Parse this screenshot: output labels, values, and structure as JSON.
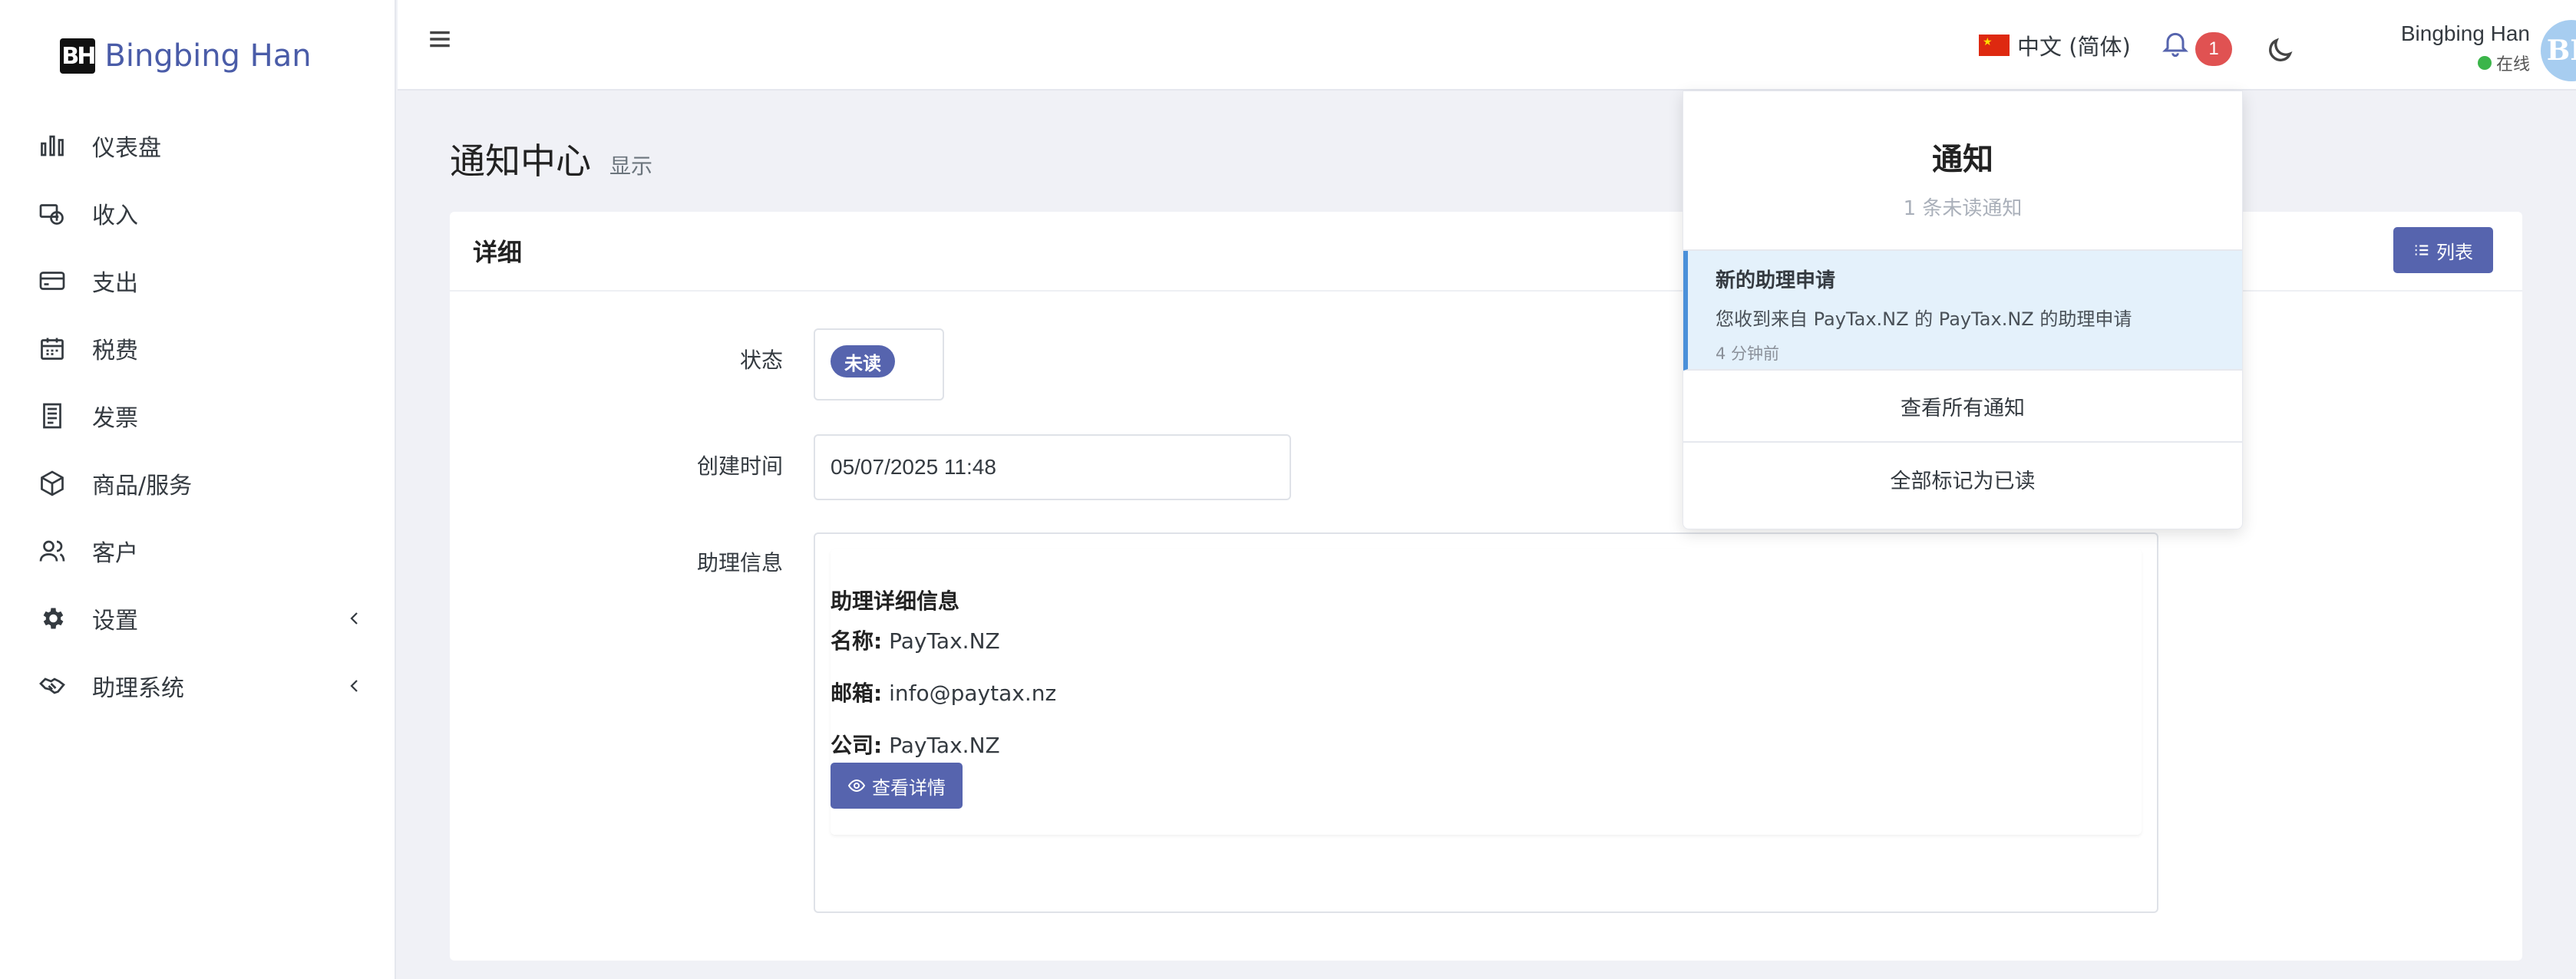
{
  "brand": {
    "logo_text": "BH",
    "name": "Bingbing Han"
  },
  "sidebar": {
    "items": [
      {
        "label": "仪表盘",
        "icon": "bar-chart-icon"
      },
      {
        "label": "收入",
        "icon": "income-icon"
      },
      {
        "label": "支出",
        "icon": "credit-card-icon"
      },
      {
        "label": "税费",
        "icon": "calendar-icon"
      },
      {
        "label": "发票",
        "icon": "receipt-icon"
      },
      {
        "label": "商品/服务",
        "icon": "box-icon"
      },
      {
        "label": "客户",
        "icon": "users-icon"
      },
      {
        "label": "设置",
        "icon": "gear-icon",
        "has_submenu": true
      },
      {
        "label": "助理系统",
        "icon": "handshake-icon",
        "has_submenu": true
      }
    ]
  },
  "topbar": {
    "language": "中文 (简体)",
    "notification_count": "1",
    "user": {
      "name": "Bingbing Han",
      "status": "在线",
      "avatar_initials": "BH"
    }
  },
  "page": {
    "title": "通知中心",
    "subtitle": "显示"
  },
  "card": {
    "header": "详细",
    "list_button": "列表",
    "fields": {
      "status_label": "状态",
      "status_value": "未读",
      "created_label": "创建时间",
      "created_value": "05/07/2025 11:48",
      "assistant_label": "助理信息"
    },
    "assistant": {
      "title": "助理详细信息",
      "name_label": "名称:",
      "name_value": "PayTax.NZ",
      "email_label": "邮箱:",
      "email_value": "info@paytax.nz",
      "company_label": "公司:",
      "company_value": "PayTax.NZ",
      "view_button": "查看详情"
    }
  },
  "notifications": {
    "title": "通知",
    "unread_text": "1 条未读通知",
    "items": [
      {
        "title": "新的助理申请",
        "message": "您收到来自 PayTax.NZ 的 PayTax.NZ 的助理申请",
        "time": "4 分钟前"
      }
    ],
    "view_all": "查看所有通知",
    "mark_all_read": "全部标记为已读"
  },
  "colors": {
    "primary": "#5664ae",
    "badge": "#e05252",
    "online": "#3bb54a",
    "highlight": "#e4f1fb"
  }
}
